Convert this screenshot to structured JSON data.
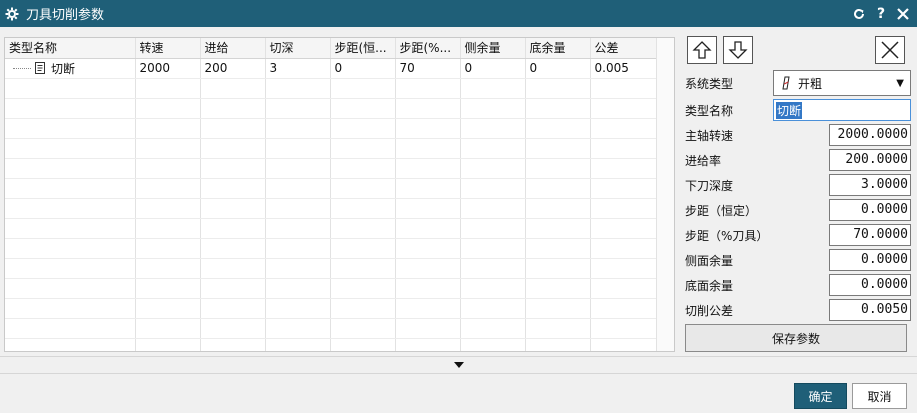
{
  "window": {
    "title": "刀具切削参数"
  },
  "grid": {
    "columns": [
      "类型名称",
      "转速",
      "进给",
      "切深",
      "步距(恒...",
      "步距(%...",
      "侧余量",
      "底余量",
      "公差"
    ],
    "rows": [
      [
        "切断",
        "2000",
        "200",
        "3",
        "0",
        "70",
        "0",
        "0",
        "0.005"
      ]
    ]
  },
  "panel": {
    "fields": {
      "system_type": {
        "label": "系统类型",
        "value": "开粗"
      },
      "type_name": {
        "label": "类型名称",
        "value": "切断"
      },
      "spindle_speed": {
        "label": "主轴转速",
        "value": "2000.0000"
      },
      "feed_rate": {
        "label": "进给率",
        "value": "200.0000"
      },
      "cut_depth": {
        "label": "下刀深度",
        "value": "3.0000"
      },
      "step_fixed": {
        "label": "步距（恒定）",
        "value": "0.0000"
      },
      "step_percent": {
        "label": "步距（%刀具）",
        "value": "70.0000"
      },
      "side_stock": {
        "label": "侧面余量",
        "value": "0.0000"
      },
      "bottom_stock": {
        "label": "底面余量",
        "value": "0.0000"
      },
      "tolerance": {
        "label": "切削公差",
        "value": "0.0050"
      }
    },
    "save_label": "保存参数"
  },
  "footer": {
    "ok_label": "确定",
    "cancel_label": "取消"
  },
  "colors": {
    "accent": "#1f5f78",
    "selection": "#3478c6"
  }
}
